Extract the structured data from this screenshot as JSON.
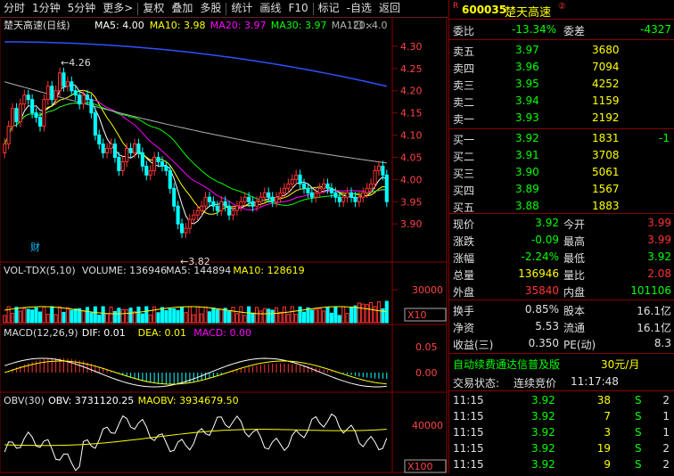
{
  "toolbar": {
    "items": [
      "分时",
      "1分钟",
      "5分钟",
      "更多>",
      "复权",
      "叠加",
      "多股",
      "统计",
      "画线",
      "F10",
      "标记",
      "-自选",
      "返回"
    ]
  },
  "main_chart": {
    "stock_label": "楚天高速(日线)",
    "ma_labels": [
      {
        "text": "MA5: 4.00",
        "color": "#ffffff"
      },
      {
        "text": "MA10: 3.98",
        "color": "#ffff00"
      },
      {
        "text": "MA20: 3.97",
        "color": "#ff00ff"
      },
      {
        "text": "MA30: 3.97",
        "color": "#00ff00"
      },
      {
        "text": "MA120: 4.0",
        "color": "#b0b0b0"
      }
    ],
    "y_ticks": [
      "4.30",
      "4.25",
      "4.20",
      "4.15",
      "4.10",
      "4.05",
      "4.00",
      "3.95",
      "3.90"
    ],
    "high_marker": "4.26",
    "low_marker": "3.82",
    "cai_marker": "财"
  },
  "vol_panel": {
    "labels": [
      {
        "text": "VOL-TDX(5,10)",
        "color": "#dddddd"
      },
      {
        "text": "VOLUME: 136946",
        "color": "#dddddd"
      },
      {
        "text": "MA5: 144894",
        "color": "#dddddd"
      },
      {
        "text": "MA10: 128619",
        "color": "#ffff00"
      }
    ],
    "y_tick": "30000",
    "unit": "X10"
  },
  "macd_panel": {
    "labels": [
      {
        "text": "MACD(12,26,9)",
        "color": "#dddddd"
      },
      {
        "text": "DIF: 0.01",
        "color": "#ffffff"
      },
      {
        "text": "DEA: 0.01",
        "color": "#ffff00"
      },
      {
        "text": "MACD: 0.00",
        "color": "#ff00ff"
      }
    ],
    "y_ticks": [
      "0.05",
      "0.00"
    ]
  },
  "obv_panel": {
    "labels": [
      {
        "text": "OBV(30)",
        "color": "#dddddd"
      },
      {
        "text": "OBV: 3731120.25",
        "color": "#ffffff"
      },
      {
        "text": "MAOBV: 3934679.50",
        "color": "#ffff00"
      }
    ],
    "y_tick": "40000",
    "unit": "X100"
  },
  "quote": {
    "code": "600035",
    "name": "楚天高速",
    "badge": "②",
    "wei_bi_label": "委比",
    "wei_bi": "-13.34%",
    "wei_cha_label": "委差",
    "wei_cha": "-4327",
    "asks": [
      {
        "label": "卖五",
        "price": "3.97",
        "vol": "3680",
        "chg": ""
      },
      {
        "label": "卖四",
        "price": "3.96",
        "vol": "7094",
        "chg": ""
      },
      {
        "label": "卖三",
        "price": "3.95",
        "vol": "4252",
        "chg": ""
      },
      {
        "label": "卖二",
        "price": "3.94",
        "vol": "1159",
        "chg": ""
      },
      {
        "label": "卖一",
        "price": "3.93",
        "vol": "2192",
        "chg": ""
      }
    ],
    "bids": [
      {
        "label": "买一",
        "price": "3.92",
        "vol": "1831",
        "chg": "-1"
      },
      {
        "label": "买二",
        "price": "3.91",
        "vol": "3708",
        "chg": ""
      },
      {
        "label": "买三",
        "price": "3.90",
        "vol": "5061",
        "chg": ""
      },
      {
        "label": "买四",
        "price": "3.89",
        "vol": "1567",
        "chg": ""
      },
      {
        "label": "买五",
        "price": "3.88",
        "vol": "1883",
        "chg": ""
      }
    ],
    "stats": [
      {
        "l1": "现价",
        "v1": "3.92",
        "c1": "green",
        "l2": "今开",
        "v2": "3.99",
        "c2": "red"
      },
      {
        "l1": "涨跌",
        "v1": "-0.09",
        "c1": "green",
        "l2": "最高",
        "v2": "3.99",
        "c2": "red"
      },
      {
        "l1": "涨幅",
        "v1": "-2.24%",
        "c1": "green",
        "l2": "最低",
        "v2": "3.92",
        "c2": "green"
      },
      {
        "l1": "总量",
        "v1": "136946",
        "c1": "yellow",
        "l2": "量比",
        "v2": "2.08",
        "c2": "red"
      },
      {
        "l1": "外盘",
        "v1": "35840",
        "c1": "red",
        "l2": "内盘",
        "v2": "101106",
        "c2": "green"
      }
    ],
    "stats2": [
      {
        "l1": "换手",
        "v1": "0.85%",
        "l2": "股本",
        "v2": "16.1亿"
      },
      {
        "l1": "净资",
        "v1": "5.53",
        "l2": "流通",
        "v2": "16.1亿"
      },
      {
        "l1": "收益(三)",
        "v1": "0.350",
        "l2": "PE(动)",
        "v2": "8.3"
      }
    ],
    "promo": "自动续费通达信普及版",
    "promo_price": "30元/月",
    "status_label": "交易状态:",
    "status_value": "连续竞价",
    "status_time": "11:17:48",
    "ticks": [
      {
        "time": "11:15",
        "price": "3.92",
        "vol": "38",
        "side": "S",
        "n": "2"
      },
      {
        "time": "11:15",
        "price": "3.92",
        "vol": "7",
        "side": "S",
        "n": "1"
      },
      {
        "time": "11:15",
        "price": "3.92",
        "vol": "3",
        "side": "S",
        "n": "1"
      },
      {
        "time": "11:15",
        "price": "3.92",
        "vol": "19",
        "side": "S",
        "n": "2"
      },
      {
        "time": "11:15",
        "price": "3.92",
        "vol": "9",
        "side": "S",
        "n": "2"
      }
    ]
  },
  "chart_data": {
    "type": "candlestick",
    "title": "楚天高速(日线)",
    "ylim": [
      3.82,
      4.33
    ],
    "closes": [
      4.08,
      4.12,
      4.16,
      4.13,
      4.17,
      4.19,
      4.18,
      4.15,
      4.14,
      4.12,
      4.18,
      4.21,
      4.18,
      4.2,
      4.24,
      4.21,
      4.22,
      4.2,
      4.19,
      4.17,
      4.19,
      4.18,
      4.15,
      4.1,
      4.08,
      4.06,
      4.07,
      4.08,
      4.05,
      4.02,
      4.04,
      4.07,
      4.06,
      4.08,
      4.06,
      4.03,
      4.01,
      4.02,
      4.05,
      4.04,
      4.03,
      4.02,
      3.98,
      3.94,
      3.9,
      3.88,
      3.89,
      3.91,
      3.92,
      3.93,
      3.94,
      3.96,
      3.95,
      3.94,
      3.93,
      3.95,
      3.94,
      3.92,
      3.93,
      3.94,
      3.95,
      3.96,
      3.95,
      3.94,
      3.95,
      3.96,
      3.97,
      3.96,
      3.95,
      3.96,
      3.97,
      3.98,
      3.99,
      4.0,
      4.01,
      3.99,
      3.98,
      3.97,
      3.96,
      3.97,
      3.98,
      3.99,
      3.98,
      3.97,
      3.96,
      3.95,
      3.96,
      3.97,
      3.96,
      3.95,
      3.96,
      3.97,
      3.98,
      3.99,
      4.02,
      4.03,
      4.01,
      3.95
    ],
    "opens": [
      4.06,
      4.08,
      4.12,
      4.16,
      4.13,
      4.17,
      4.19,
      4.18,
      4.15,
      4.14,
      4.12,
      4.18,
      4.21,
      4.18,
      4.2,
      4.24,
      4.21,
      4.22,
      4.2,
      4.19,
      4.17,
      4.19,
      4.18,
      4.15,
      4.1,
      4.08,
      4.06,
      4.07,
      4.08,
      4.05,
      4.02,
      4.04,
      4.07,
      4.06,
      4.08,
      4.06,
      4.03,
      4.01,
      4.02,
      4.05,
      4.04,
      4.03,
      4.02,
      3.98,
      3.94,
      3.9,
      3.88,
      3.89,
      3.91,
      3.92,
      3.93,
      3.94,
      3.96,
      3.95,
      3.94,
      3.93,
      3.95,
      3.94,
      3.92,
      3.93,
      3.94,
      3.95,
      3.96,
      3.95,
      3.94,
      3.95,
      3.96,
      3.97,
      3.96,
      3.95,
      3.96,
      3.97,
      3.98,
      3.99,
      4.0,
      4.01,
      3.99,
      3.98,
      3.97,
      3.96,
      3.97,
      3.98,
      3.99,
      3.98,
      3.97,
      3.96,
      3.95,
      3.96,
      3.97,
      3.96,
      3.95,
      3.96,
      3.97,
      3.98,
      3.99,
      4.02,
      4.03,
      4.01
    ]
  }
}
